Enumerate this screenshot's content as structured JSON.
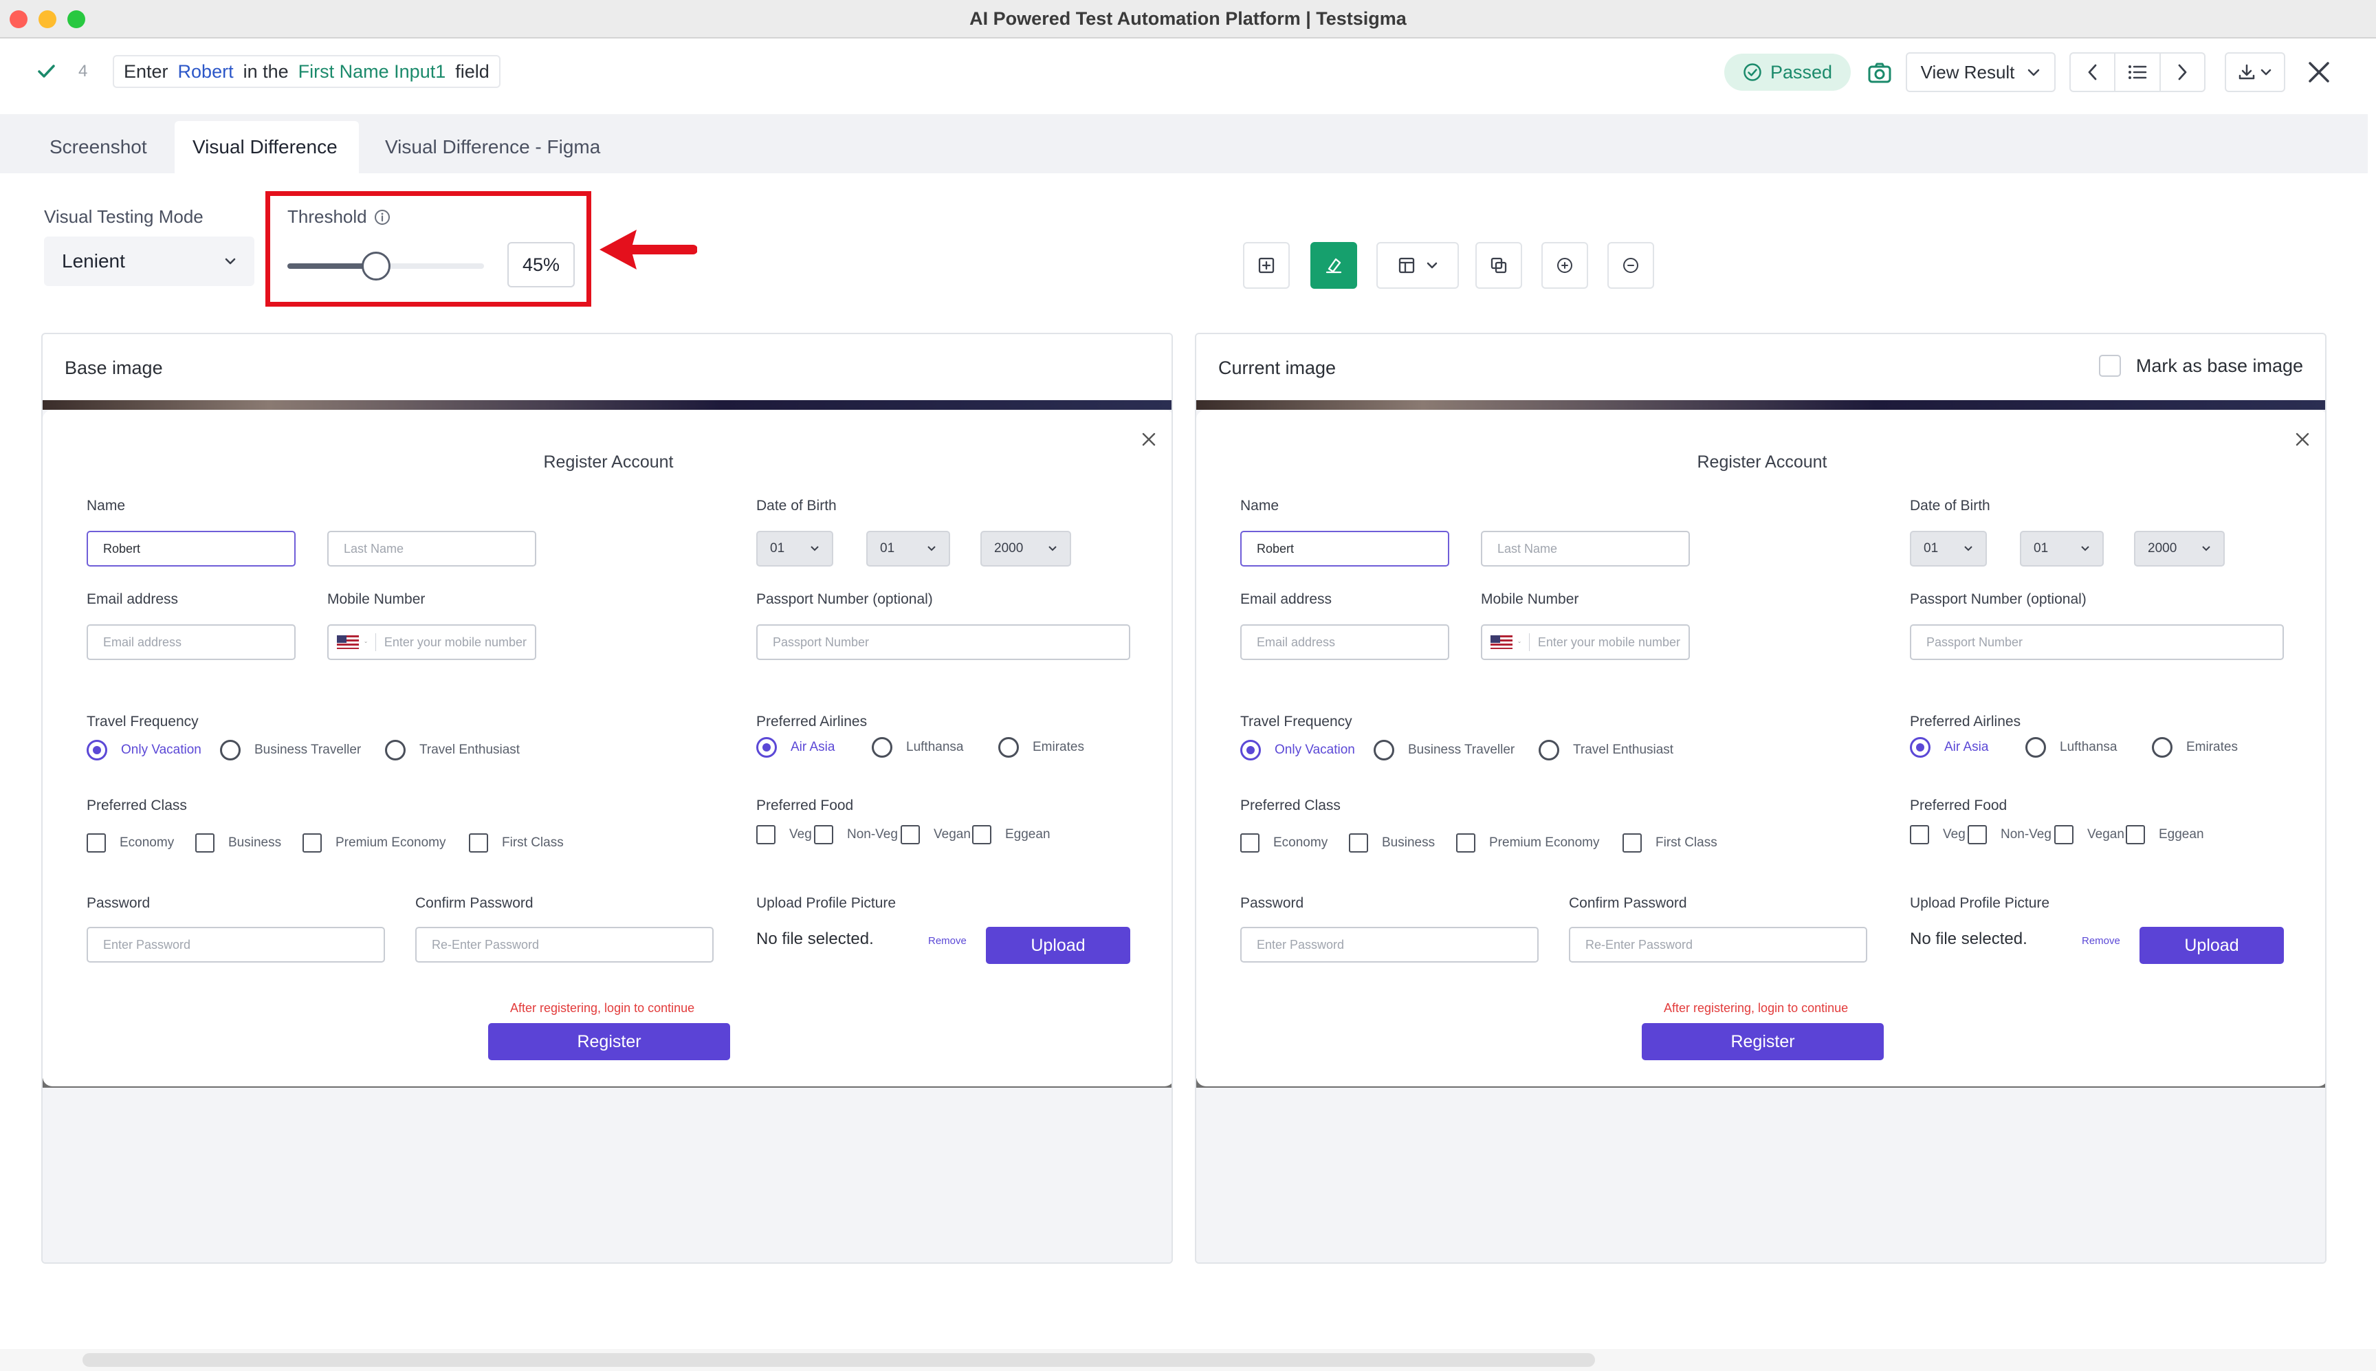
{
  "window": {
    "title": "AI Powered Test Automation Platform | Testsigma"
  },
  "step": {
    "number": "4",
    "action": "Enter",
    "value": "Robert",
    "connector": "in the",
    "element": "First Name Input1",
    "suffix": "field",
    "status": "Passed",
    "view_result": "View Result"
  },
  "tabs": [
    {
      "label": "Screenshot"
    },
    {
      "label": "Visual Difference"
    },
    {
      "label": "Visual Difference - Figma"
    }
  ],
  "controls": {
    "mode_label": "Visual Testing Mode",
    "mode_value": "Lenient",
    "threshold_label": "Threshold",
    "threshold_value": "45%",
    "threshold_fraction": 0.45
  },
  "panels": {
    "base_title": "Base image",
    "current_title": "Current image",
    "mark_base": "Mark as base image"
  },
  "form": {
    "title": "Register Account",
    "name_label": "Name",
    "first_name_value": "Robert",
    "last_name_placeholder": "Last Name",
    "dob_label": "Date of Birth",
    "dob_day": "01",
    "dob_month": "01",
    "dob_year": "2000",
    "email_label": "Email address",
    "email_placeholder": "Email address",
    "mobile_label": "Mobile Number",
    "mobile_placeholder": "Enter your mobile number",
    "passport_label": "Passport Number (optional)",
    "passport_placeholder": "Passport Number",
    "travel_label": "Travel Frequency",
    "travel_options": [
      "Only Vacation",
      "Business Traveller",
      "Travel Enthusiast"
    ],
    "airlines_label": "Preferred Airlines",
    "airline_options": [
      "Air Asia",
      "Lufthansa",
      "Emirates"
    ],
    "class_label": "Preferred Class",
    "class_options": [
      "Economy",
      "Business",
      "Premium Economy",
      "First Class"
    ],
    "food_label": "Preferred Food",
    "food_options": [
      "Veg",
      "Non-Veg",
      "Vegan",
      "Eggean"
    ],
    "password_label": "Password",
    "password_placeholder": "Enter Password",
    "confirm_label": "Confirm Password",
    "confirm_placeholder": "Re-Enter Password",
    "upload_label": "Upload Profile Picture",
    "no_file": "No file selected.",
    "remove": "Remove",
    "upload_btn": "Upload",
    "notice": "After registering, login to continue",
    "register_btn": "Register"
  },
  "colors": {
    "passed_green": "#1b8a6b",
    "accent_purple": "#5b43d6",
    "highlight_red": "#e4101c",
    "active_tool_green": "#16a06d"
  }
}
